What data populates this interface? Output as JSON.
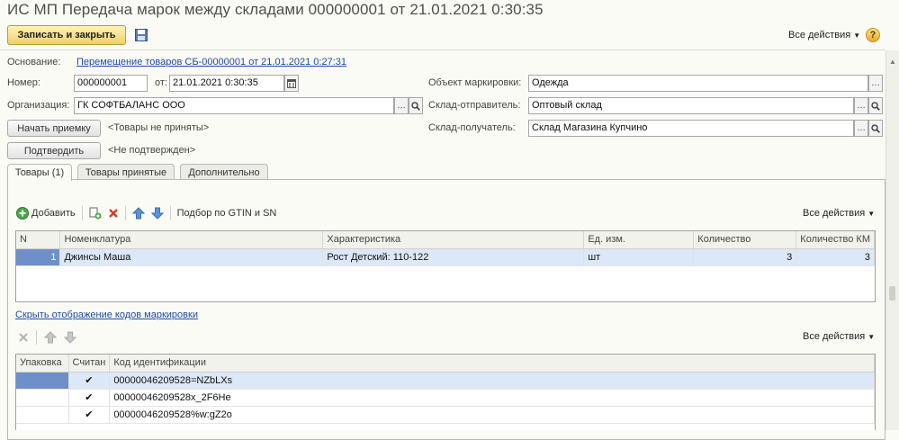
{
  "window": {
    "title": "ИС МП Передача марок между складами 000000001 от 21.01.2021 0:30:35"
  },
  "toolbar": {
    "save_close_label": "Записать и закрыть",
    "save_icon": "floppy-disk-icon",
    "all_actions_label": "Все действия",
    "help_icon": "?"
  },
  "form": {
    "basis_label": "Основание:",
    "basis_link": "Перемещение товаров СБ-00000001 от 21.01.2021 0:27:31",
    "number_label": "Номер:",
    "number_value": "000000001",
    "date_label": "от:",
    "date_value": "21.01.2021  0:30:35",
    "org_label": "Организация:",
    "org_value": "ГК СОФТБАЛАНС ООО",
    "start_accept_label": "Начать приемку",
    "goods_status": "<Товары не приняты>",
    "confirm_label": "Подтвердить",
    "confirm_status": "<Не подтвержден>",
    "marking_object_label": "Объект маркировки:",
    "marking_object_value": "Одежда",
    "sender_label": "Склад-отправитель:",
    "sender_value": "Оптовый склад",
    "receiver_label": "Склад-получатель:",
    "receiver_value": "Склад Магазина Купчино"
  },
  "tabs": [
    {
      "label": "Товары (1)",
      "active": true
    },
    {
      "label": "Товары принятые",
      "active": false
    },
    {
      "label": "Дополнительно",
      "active": false
    }
  ],
  "goods_toolbar": {
    "add_label": "Добавить",
    "pick_label": "Подбор по GTIN и SN",
    "all_actions_label": "Все действия"
  },
  "goods_table": {
    "columns": [
      "N",
      "Номенклатура",
      "Характеристика",
      "Ед. изм.",
      "Количество",
      "Количество КМ"
    ],
    "rows": [
      [
        "1",
        "Джинсы Маша",
        "Рост Детский: 110-122",
        "шт",
        "3",
        "3"
      ]
    ]
  },
  "codes_link": "Скрыть отображение кодов маркировки",
  "codes_toolbar": {
    "all_actions_label": "Все действия"
  },
  "codes_table": {
    "columns": [
      "Упаковка",
      "Считан",
      "Код идентификации"
    ],
    "rows": [
      [
        "",
        "✔",
        "00000046209528=NZbLXs"
      ],
      [
        "",
        "✔",
        "00000046209528x_2F6He"
      ],
      [
        "",
        "✔",
        "00000046209528%w:gZ2o"
      ]
    ]
  },
  "colors": {
    "primary_button": "#f1cf66",
    "link": "#1f4ba8",
    "selected_row": "#dce8f7",
    "current_cell": "#6f8fc9"
  }
}
